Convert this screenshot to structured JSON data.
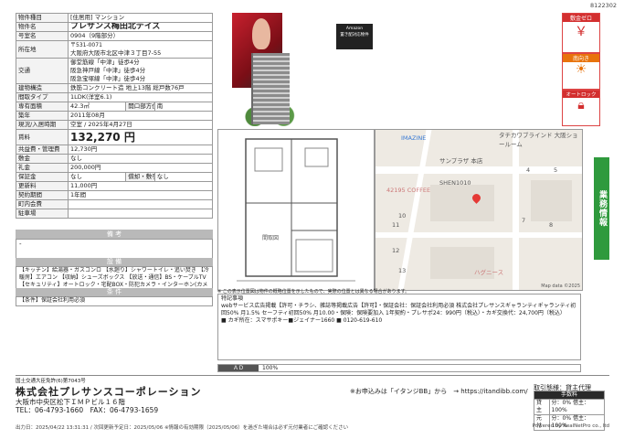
{
  "doc_id": "8122302",
  "spec": {
    "kind_label": "物件種目",
    "kind": "[住居用] マンション",
    "name_label": "物件名",
    "name": "プレサンス梅田北デイズ",
    "room_label": "号室名",
    "room": "0904（9階部分）",
    "addr_label": "所在地",
    "postcode": "〒531-0071",
    "addr": "大阪府大阪市北区中津３丁目7-55",
    "traffic_label": "交通",
    "traffic1": "御堂筋線「中津」徒歩4分",
    "traffic2": "阪急神戸線「中津」徒歩4分",
    "traffic3": "阪急宝塚線「中津」徒歩4分",
    "struct_label": "建物構造",
    "struct": "鉄筋コンクリート造 地上13階 総戸数76戸",
    "layout_label": "間取タイプ",
    "layout": "1LDK(洋室6.1)",
    "area_label": "専有面積",
    "area": "42.3㎡",
    "window_label": "開口部方位",
    "window": "南",
    "built_label": "築年",
    "built": "2011年08月",
    "status_label": "現況/入居時期",
    "status": "空室 / 2025年4月27日",
    "rent_label": "賃料",
    "rent": "132,270 円",
    "fee_label": "共益費・管理費",
    "fee": "12,730円",
    "shiki_label": "敷金",
    "shiki": "なし",
    "rei_label": "礼金",
    "rei": "200,000円",
    "hosho_label": "保証金",
    "hosho": "なし",
    "kyakan_label": "償却・敷引",
    "kyakan": "なし",
    "renew_label": "更新料",
    "renew": "11,000円",
    "period_label": "契約期間",
    "period": "1年間",
    "inner_label": "町内会費",
    "inner": "",
    "parking_label": "駐車場",
    "parking": ""
  },
  "biko": {
    "title": "備 考",
    "text": "-"
  },
  "setsubi": {
    "title": "設 備",
    "text": "【キッチン】給湯器・ガスコンロ 【水廻り】シャワートイレ・追い焚き 【冷暖房】エアコン 【収納】シューズボックス 【放送・通信】BS・ケーブルTV 【セキュリティ】オートロック・宅配BOX・防犯カメラ・インターホン(カメラ付き) 【その他】エレベーター・24時間換気システム"
  },
  "joken": {
    "title": "条 件",
    "text": "【条件】保証会社利用必須"
  },
  "photo": {
    "amazon_line1": "Amazon",
    "amazon_line2": "置き配対応物件"
  },
  "plan_label": "間取図",
  "map": {
    "labels": [
      "IMAZINE",
      "サンプラザ 本店",
      "SHEN1010",
      "42195 COFFEE",
      "タチカワブラインド 大阪ショールーム",
      "ハグニース"
    ],
    "numbers": [
      "4",
      "5",
      "7",
      "8",
      "10",
      "11",
      "12",
      "13"
    ],
    "credit": "Map data ©2025",
    "note": "※ この表示位置図は物件の概略位置を示したもので、実際の位置とは異なる場合があります。"
  },
  "side": {
    "badge1": "敷金ゼロ",
    "badge2": "南向き",
    "badge3": "オートロック",
    "vert": "業務情報"
  },
  "remarks": {
    "title": "特記事項",
    "text": "webサービス広告掲載【許可・チラシ、雑誌等掲載広告【許可】・保証会社：保証会社利用必須 株式会社プレサンスギャランティギャランティ初回50% 月1.5% セーフティ初回50% 月10.00・保険：保険要加入 1年契約・プレサポ24：990円（税込）・カギ交換代：24,700円（税込）",
    "key": "■ カギ所在：スマサポキー■ジェイナー1660 ■ 0120-619-610"
  },
  "ad": {
    "label": "ＡＤ",
    "value": "100%"
  },
  "company": {
    "license": "国土交通大臣免許(6)第7043号",
    "name": "株式会社プレサンスコーポレーション",
    "address": "大阪市中央区松下ＩＭＰビル１６階",
    "tel": "TEL：06-4793-1660　FAX：06-4793-1659",
    "apply": "※お申込みは「イタンジBB」から　→ https://itandibb.com/"
  },
  "tori": {
    "header": "取引態様：貸主代理",
    "fee": "手数料",
    "row1_label": "貸主",
    "row1": "分：0% 借主：100%",
    "row2_label": "元付",
    "row2": "分：0% 借主：100%"
  },
  "footer": {
    "left": "出力日：2025/04/22 13:31:31 / 次回更新予定日：2025/05/06 ※情報の有効期限（2025/05/06）を過ぎた場合は必ず元付業者にご確認ください",
    "right": "Powered by RealNetPro co., ltd"
  }
}
